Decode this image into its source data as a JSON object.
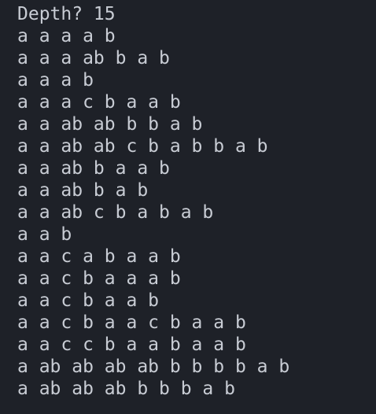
{
  "terminal": {
    "prompt": "Depth? 15",
    "output_lines": [
      "a a a a b",
      "a a a ab b a b",
      "a a a b",
      "a a a c b a a b",
      "a a ab ab b b a b",
      "a a ab ab c b a b b a b",
      "a a ab b a a b",
      "a a ab b a b",
      "a a ab c b a b a b",
      "a a b",
      "a a c a b a a b",
      "a a c b a a a b",
      "a a c b a a b",
      "a a c b a a c b a a b",
      "a a c c b a a b a a b",
      "a ab ab ab ab b b b b a b",
      "a ab ab ab b b b a b"
    ]
  },
  "colors": {
    "background": "#1e2128",
    "text": "#c8ccd4"
  }
}
